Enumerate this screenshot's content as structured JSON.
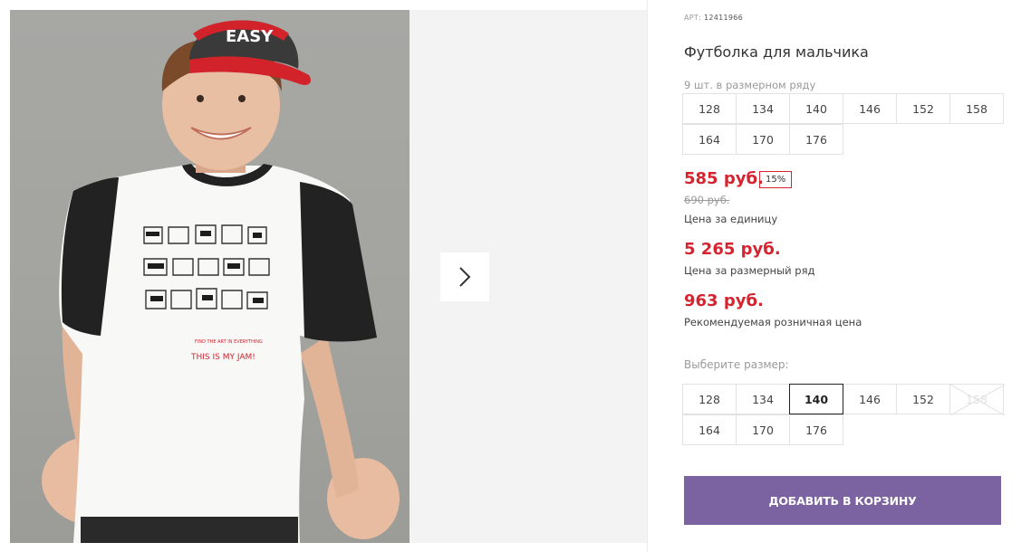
{
  "product": {
    "art_label": "АРТ:",
    "art_number": "12411966",
    "title": "Футболка для мальчика",
    "photo_print": {
      "line1": "FIND THE ART IN EVERYTHING",
      "line2": "THIS IS MY JAM!",
      "cap_text": "EASY"
    }
  },
  "pack": {
    "label": "9 шт. в размерном ряду",
    "sizes_row1": [
      "128",
      "134",
      "140",
      "146",
      "152",
      "158"
    ],
    "sizes_row2": [
      "164",
      "170",
      "176"
    ]
  },
  "pricing": {
    "price": "585 руб.",
    "discount": "15%",
    "old_price": "690 руб.",
    "unit_caption": "Цена за единицу",
    "series_price": "5 265 руб.",
    "series_caption": "Цена за размерный ряд",
    "rrp_price": "963 руб.",
    "rrp_caption": "Рекомендуемая розничная цена",
    "price_color": "#d6242f"
  },
  "choose": {
    "label": "Выберите размер:",
    "sizes_row1": [
      "128",
      "134",
      "140",
      "146",
      "152",
      "158"
    ],
    "sizes_row2": [
      "164",
      "170",
      "176"
    ],
    "selected": "140",
    "unavailable": [
      "158"
    ]
  },
  "cart": {
    "add_label": "ДОБАВИТЬ В КОРЗИНУ",
    "button_color": "#7b63a1"
  },
  "gallery": {
    "next_icon": "chevron-right-icon"
  }
}
